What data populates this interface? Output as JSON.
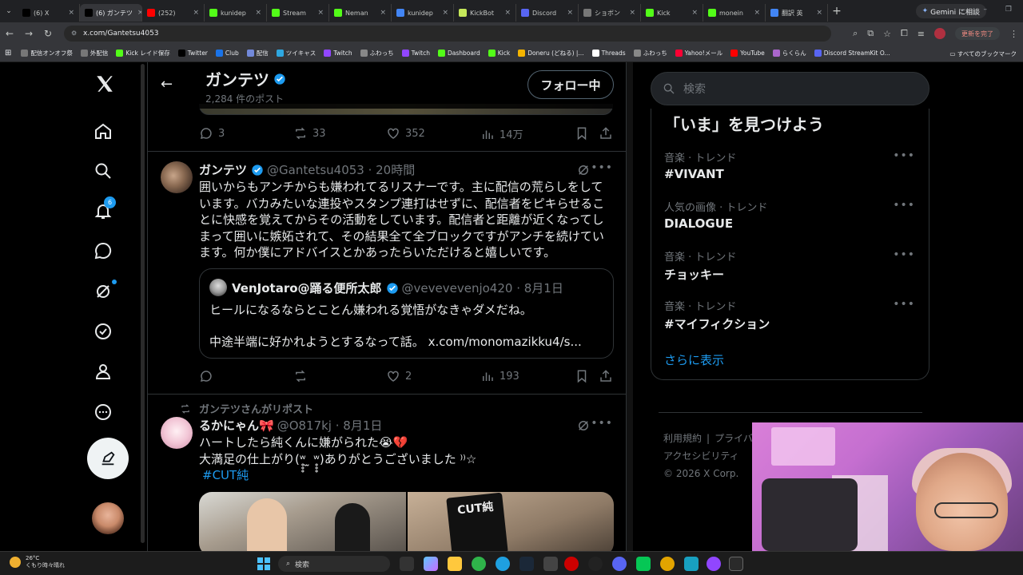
{
  "browser": {
    "tabs": [
      {
        "label": "(6) X",
        "icon": "x-icon",
        "color": "#000000"
      },
      {
        "label": "(6) ガンテツ",
        "icon": "x-icon",
        "color": "#000000",
        "active": true
      },
      {
        "label": "(252)",
        "icon": "youtube-icon",
        "color": "#ff0000"
      },
      {
        "label": "kunidep",
        "icon": "kick-icon",
        "color": "#53fc18"
      },
      {
        "label": "Stream",
        "icon": "kick-icon",
        "color": "#53fc18"
      },
      {
        "label": "Neman",
        "icon": "kick-icon",
        "color": "#53fc18"
      },
      {
        "label": "kunidep",
        "icon": "loading-icon",
        "color": "#4285f4"
      },
      {
        "label": "KickBot",
        "icon": "kickbot-icon",
        "color": "#c6e85a"
      },
      {
        "label": "Discord",
        "icon": "discord-icon",
        "color": "#5865f2"
      },
      {
        "label": "ショボン",
        "icon": "page-icon",
        "color": "#777777"
      },
      {
        "label": "Kick",
        "icon": "kick-icon",
        "color": "#53fc18"
      },
      {
        "label": "monein",
        "icon": "kick-icon",
        "color": "#53fc18"
      },
      {
        "label": "翻訳 英",
        "icon": "google-icon",
        "color": "#4285f4"
      }
    ],
    "new_tab": "+",
    "gemini_label": "Gemini に相談",
    "url": "x.com/Gantetsu4053",
    "update_label": "更新を完了",
    "bookmarks": [
      {
        "label": "配信オンオフ祭",
        "color": "#777777"
      },
      {
        "label": "外配信",
        "color": "#777777"
      },
      {
        "label": "Kick レイド保存",
        "color": "#53fc18"
      },
      {
        "label": "Twitter",
        "color": "#000000"
      },
      {
        "label": "Club",
        "color": "#1a73e8"
      },
      {
        "label": "配信",
        "color": "#7289da"
      },
      {
        "label": "ツイキャス",
        "color": "#2ea7e0"
      },
      {
        "label": "Twitch",
        "color": "#9146ff"
      },
      {
        "label": "ふわっち",
        "color": "#888888"
      },
      {
        "label": "Twitch",
        "color": "#9146ff"
      },
      {
        "label": "Dashboard",
        "color": "#53fc18"
      },
      {
        "label": "Kick",
        "color": "#53fc18"
      },
      {
        "label": "Doneru (どねる) |...",
        "color": "#f4b400"
      },
      {
        "label": "Threads",
        "color": "#ffffff"
      },
      {
        "label": "ふわっち",
        "color": "#888888"
      },
      {
        "label": "Yahoo!メール",
        "color": "#ff0033"
      },
      {
        "label": "YouTube",
        "color": "#ff0000"
      },
      {
        "label": "らくらん",
        "color": "#aa66cc"
      },
      {
        "label": "Discord StreamKit O...",
        "color": "#5865f2"
      }
    ],
    "all_bookmarks": "すべてのブックマーク"
  },
  "header": {
    "name": "ガンテツ",
    "post_count": "2,284 件のポスト",
    "follow_label": "フォロー中"
  },
  "top_actions": {
    "replies": "3",
    "reposts": "33",
    "likes": "352",
    "views": "14万"
  },
  "tweet1": {
    "name": "ガンテツ",
    "handle": "@Gantetsu4053 · 20時間",
    "lines": [
      "囲いからもアンチからも嫌われてるリスナーです。主に配信の荒らしをして",
      "います。バカみたいな連投やスタンプ連打はせずに、配信者をピキらせるこ",
      "とに快感を覚えてからその活動をしています。配信者と距離が近くなってし",
      "まって囲いに嫉妬されて、その結果全て全ブロックですがアンチを続けてい",
      "ます。何か僕にアドバイスとかあったらいただけると嬉しいです。"
    ],
    "quote": {
      "name": "VenJotaro@踊る便所太郎",
      "handle": "@vevevevenjo420 · 8月1日",
      "line1": "ヒールになるならとことん嫌われる覚悟がなきゃダメだね。",
      "line2": "中途半端に好かれようとするなって話。 x.com/monomazikku4/s..."
    },
    "actions": {
      "replies": "",
      "reposts": "",
      "likes": "2",
      "views": "193"
    }
  },
  "tweet2": {
    "repost_line": "ガンテツさんがリポスト",
    "name": "るかにゃん🎀",
    "handle": "@O817kj · 8月1日",
    "line1": "ハートしたら純くんに嫌がられた😭💔",
    "line2": "大満足の仕上がり(ʷ̥̥̥ ̫ ʷ̥̥̥)ありがとうございました ⁾⁾☆",
    "hashtag": "#CUT純",
    "image_text": "CUT純"
  },
  "sidebar": {
    "search_placeholder": "検索",
    "trends_title": "「いま」を見つけよう",
    "trends": [
      {
        "category": "音楽 · トレンド",
        "name": "#VIVANT"
      },
      {
        "category": "人気の画像 · トレンド",
        "name": "DIALOGUE"
      },
      {
        "category": "音楽 · トレンド",
        "name": "チョッキー"
      },
      {
        "category": "音楽 · トレンド",
        "name": "#マイフィクション"
      }
    ],
    "show_more": "さらに表示",
    "footer": [
      "利用規約",
      "プライバ",
      "アクセシビリティ",
      "© 2026 X Corp."
    ]
  },
  "nav": {
    "notification_count": "6"
  },
  "taskbar": {
    "temp": "26°C",
    "weather": "くもり時々晴れ",
    "search": "検索"
  }
}
